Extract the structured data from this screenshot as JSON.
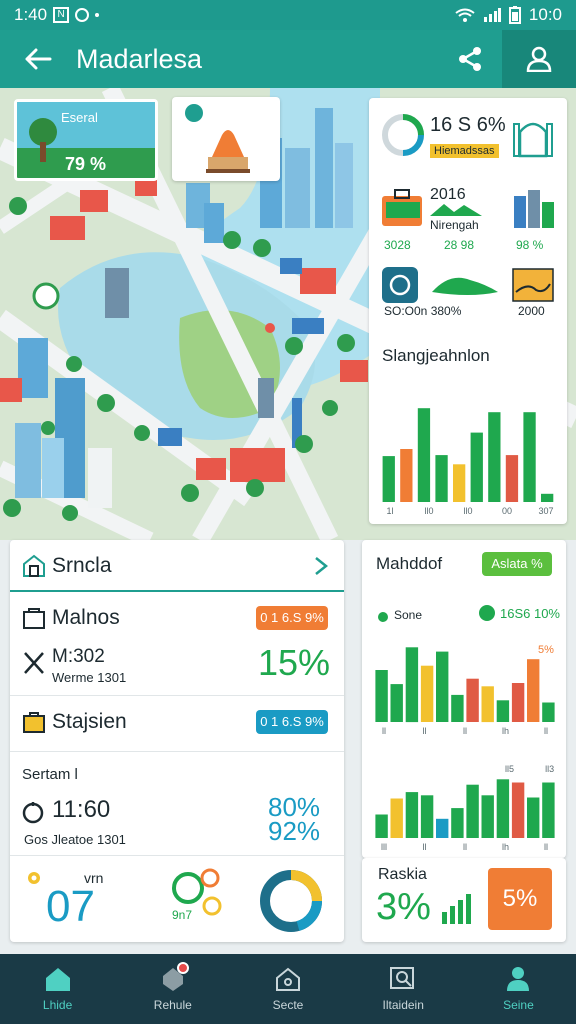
{
  "status_bar": {
    "time": "1:40",
    "box_glyph": "N",
    "battery_time": "10:0"
  },
  "app_bar": {
    "title": "Madarlesa"
  },
  "map": {
    "park_badge": {
      "label": "Eseral",
      "value": "79 %"
    }
  },
  "stats": {
    "row1_value": "16 S 6%",
    "row1_chip": "Hiemadssas",
    "row2_year": "2016",
    "row2_label": "Nirengah",
    "row2_left": "3028",
    "row2_mid": "28 98",
    "row2_right": "98 %",
    "row3_left": "SO:O0n 380%",
    "row3_right": "2000",
    "chart_title": "Slangjeahnlon"
  },
  "list": {
    "header": {
      "title": "Srncla"
    },
    "rows": [
      {
        "title": "Malnos",
        "pill": "0 1 6.S 9%"
      },
      {
        "title": "Stajsien",
        "pill": "0 1 6.S 9%"
      }
    ],
    "metric1": {
      "label": "M:302",
      "sub": "Werme 1301",
      "value": "15%"
    },
    "section": {
      "label": "Sertam l"
    },
    "metric2": {
      "label": "11:60",
      "sub": "Gos Jleatoe 1301",
      "value1": "80%",
      "value2": "92%"
    },
    "footer": {
      "small": "vrn",
      "big": "07",
      "badge": "9n7"
    }
  },
  "right_card": {
    "title": "Mahddof",
    "chip": "Aslata %",
    "legend_label": "Sone",
    "legend_value": "16S6 10%",
    "top_label": "5%"
  },
  "bottom_right": {
    "label": "Raskia",
    "value": "3%",
    "pill": "5%"
  },
  "nav": {
    "items": [
      {
        "label": "Lhide"
      },
      {
        "label": "Rehule"
      },
      {
        "label": "Secte"
      },
      {
        "label": "Iltaidein"
      },
      {
        "label": "Seine"
      }
    ]
  },
  "colors": {
    "teal": "#1f9e90",
    "green": "#1fa84e",
    "yellow": "#f2c12e",
    "orange": "#f07d35",
    "red": "#e05a44",
    "blue": "#1a9bc4",
    "nav_bg": "#1a3a46"
  },
  "chart_data": [
    {
      "type": "bar",
      "title": "Slangjeahnlon",
      "categories": [
        "1",
        "2",
        "3",
        "4",
        "5",
        "6",
        "7",
        "8",
        "9",
        "10"
      ],
      "values": [
        45,
        52,
        92,
        46,
        37,
        68,
        88,
        46,
        88,
        8
      ],
      "bar_colors": [
        "green",
        "orange",
        "green",
        "green",
        "yellow",
        "green",
        "green",
        "red",
        "green",
        "green"
      ],
      "tick_labels": [
        "1l",
        "ll0",
        "ll0",
        "00",
        "307"
      ]
    },
    {
      "type": "bar",
      "title": "Mahddof",
      "categories": [
        "1",
        "2",
        "3",
        "4",
        "5",
        "6",
        "7",
        "8",
        "9",
        "10",
        "11",
        "12"
      ],
      "values": [
        48,
        35,
        69,
        52,
        65,
        25,
        40,
        33,
        20,
        36,
        58,
        18
      ],
      "bar_colors": [
        "green",
        "green",
        "green",
        "yellow",
        "green",
        "green",
        "red",
        "yellow",
        "green",
        "red",
        "orange",
        "green"
      ],
      "tick_labels": [
        "ll",
        "ll",
        "ll",
        "lh",
        "ll"
      ]
    },
    {
      "type": "bar",
      "categories": [
        "1",
        "2",
        "3",
        "4",
        "5",
        "6",
        "7",
        "8",
        "9",
        "10",
        "11",
        "12"
      ],
      "values": [
        22,
        37,
        43,
        40,
        18,
        28,
        50,
        40,
        55,
        52,
        38,
        52
      ],
      "bar_colors": [
        "green",
        "yellow",
        "green",
        "green",
        "blue",
        "green",
        "green",
        "green",
        "green",
        "red",
        "green",
        "green"
      ],
      "tick_labels": [
        "lll",
        "ll",
        "ll",
        "lh",
        "ll"
      ],
      "top_labels": [
        "ll5",
        "ll3"
      ]
    }
  ]
}
